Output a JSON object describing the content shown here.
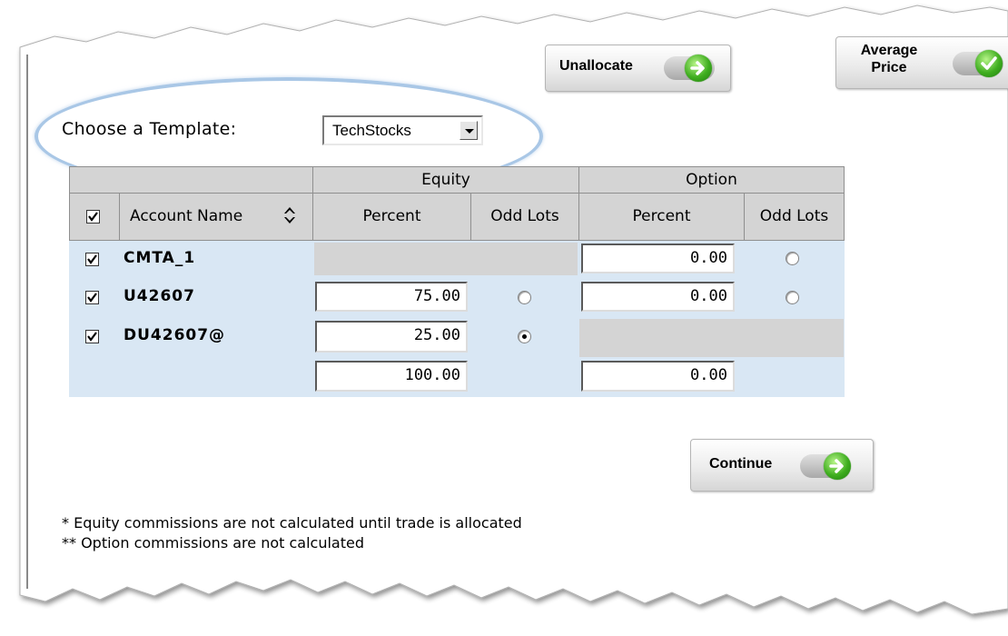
{
  "toolbar": {
    "unallocate_label": "Unallocate",
    "average_price_line1": "Average",
    "average_price_line2": "Price"
  },
  "template": {
    "label": "Choose a Template:",
    "selected": "TechStocks"
  },
  "table": {
    "group_headers": {
      "equity": "Equity",
      "option": "Option"
    },
    "columns": {
      "account_name": "Account Name",
      "equity_percent": "Percent",
      "equity_odd_lots": "Odd Lots",
      "option_percent": "Percent",
      "option_odd_lots": "Odd Lots"
    },
    "select_all_checked": true,
    "rows": [
      {
        "checked": true,
        "account": "CMTA_1",
        "equity_percent": null,
        "equity_odd_lot_selected": null,
        "option_percent": "0.00",
        "option_odd_lot_selected": false
      },
      {
        "checked": true,
        "account": "U42607",
        "equity_percent": "75.00",
        "equity_odd_lot_selected": false,
        "option_percent": "0.00",
        "option_odd_lot_selected": false
      },
      {
        "checked": true,
        "account": "DU42607@",
        "equity_percent": "25.00",
        "equity_odd_lot_selected": true,
        "option_percent": null,
        "option_odd_lot_selected": null
      }
    ],
    "totals": {
      "equity_percent": "100.00",
      "option_percent": "0.00"
    }
  },
  "continue_label": "Continue",
  "notes": [
    "* Equity commissions are not calculated until trade is allocated",
    "** Option commissions are not calculated"
  ],
  "colors": {
    "highlight_ellipse": "#a9c7e6",
    "row_band": "#d9e7f4",
    "header_grey": "#d4d4d4",
    "button_green": "#3fae1f"
  }
}
